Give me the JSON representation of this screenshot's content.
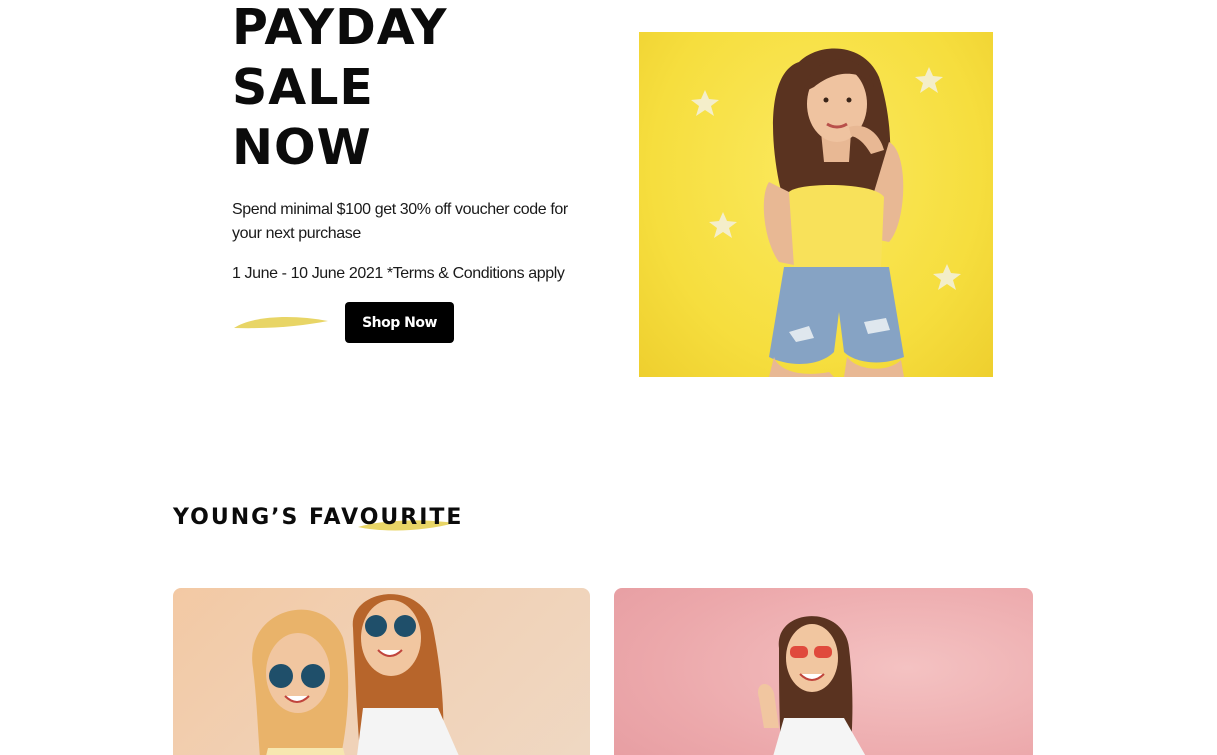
{
  "hero": {
    "title_lines": [
      "PAYDAY",
      "SALE",
      "NOW"
    ],
    "description": "Spend minimal $100 get 30% off voucher code for your next purchase",
    "dates": "1 June - 10 June 2021 *Terms & Conditions apply",
    "cta_label": "Shop Now",
    "image_alt": "Woman in yellow top and denim shorts against yellow background"
  },
  "favourites": {
    "title": "YOUNG’S FAVOURITE",
    "cards": [
      {
        "alt": "Two friends wearing sunglasses laughing"
      },
      {
        "alt": "Woman with red sunglasses on pink background"
      }
    ]
  },
  "colors": {
    "accent_yellow": "#e8d566",
    "button_black": "#000000",
    "hero_bg_yellow": "#f6de3e"
  }
}
